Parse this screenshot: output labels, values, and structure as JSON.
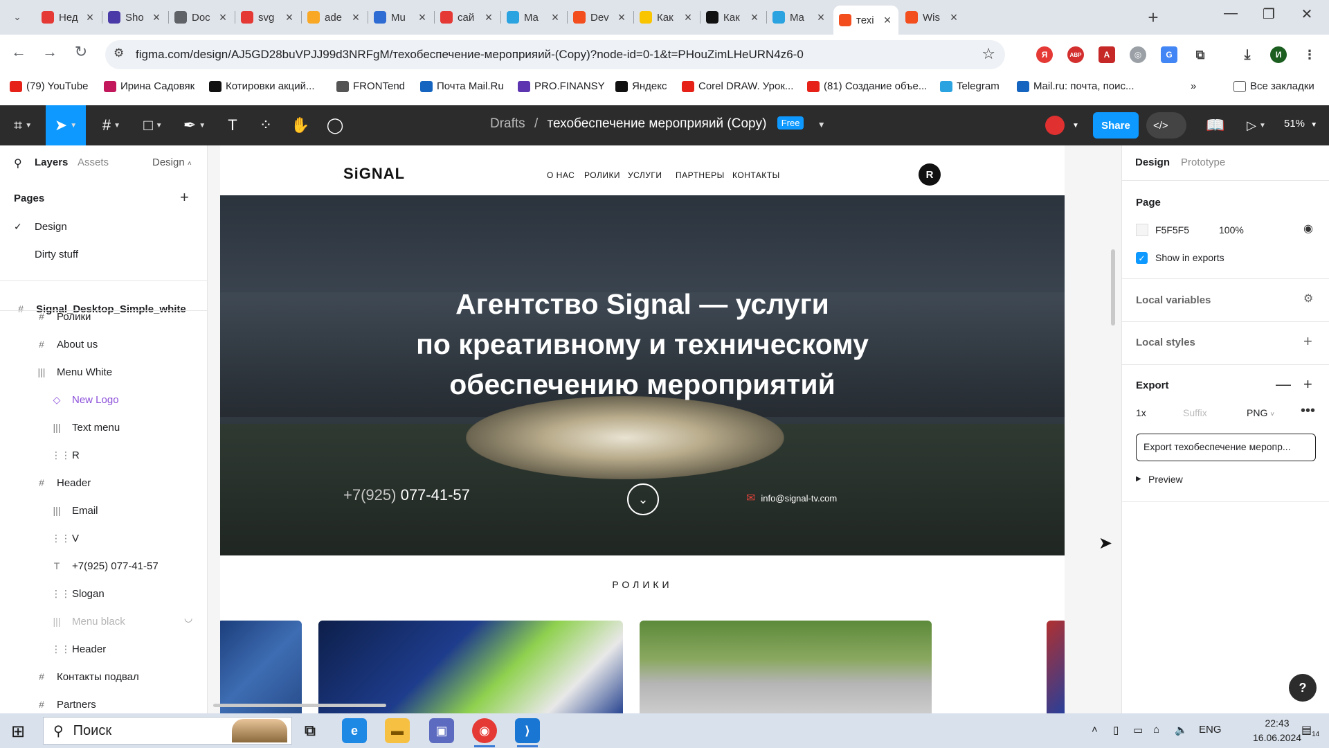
{
  "browser": {
    "tabs": [
      {
        "label": "Нед",
        "color": "#e53935"
      },
      {
        "label": "Sho",
        "color": "#4a3aa8"
      },
      {
        "label": "Doc",
        "color": "#5f6368"
      },
      {
        "label": "svg",
        "color": "#e53935"
      },
      {
        "label": "ade",
        "color": "#f9a825"
      },
      {
        "label": "Mu",
        "color": "#2e6bd3"
      },
      {
        "label": "сай",
        "color": "#e53935"
      },
      {
        "label": "Ma",
        "color": "#2aa3e0"
      },
      {
        "label": "Dev",
        "color": "#f24e1e"
      },
      {
        "label": "Как",
        "color": "#f9c400"
      },
      {
        "label": "Как",
        "color": "#111111"
      },
      {
        "label": "Ma",
        "color": "#2aa3e0"
      },
      {
        "label": "техі",
        "color": "#f24e1e",
        "active": true
      },
      {
        "label": "Wis",
        "color": "#f24e1e"
      }
    ],
    "url": "figma.com/design/AJ5GD28buVPJJ99d3NRFgM/техобеспечение-мероприяий-(Copy)?node-id=0-1&t=PHouZimLHeURN4z6-0",
    "profile_initial": "И",
    "bookmarks": [
      {
        "label": "(79) YouTube",
        "color": "#e62117"
      },
      {
        "label": "Ирина Садовяк",
        "color": "#c2185b"
      },
      {
        "label": "Котировки акций...",
        "color": "#111111"
      },
      {
        "label": "FRONTend",
        "color": "#555555"
      },
      {
        "label": "Почта Mail.Ru",
        "color": "#1565c0"
      },
      {
        "label": "PRO.FINANSY",
        "color": "#5e35b1"
      },
      {
        "label": "Яндекс",
        "color": "#111111"
      },
      {
        "label": "Corel DRAW. Урок...",
        "color": "#e62117"
      },
      {
        "label": "(81) Создание объе...",
        "color": "#e62117"
      },
      {
        "label": "Telegram",
        "color": "#2aa3e0"
      },
      {
        "label": "Mail.ru: почта, поис...",
        "color": "#1565c0"
      }
    ],
    "all_bookmarks": "Все закладки"
  },
  "figma": {
    "breadcrumb_root": "Drafts",
    "breadcrumb_sep": "/",
    "file_title": "техобеспечение мероприяий (Copy)",
    "plan_badge": "Free",
    "share_label": "Share",
    "zoom": "51%",
    "left": {
      "tab_layers": "Layers",
      "tab_assets": "Assets",
      "mode": "Design",
      "pages_title": "Pages",
      "pages": [
        {
          "label": "Design",
          "current": true
        },
        {
          "label": "Dirty stuff",
          "current": false
        }
      ],
      "frame_name": "Signal_Desktop_Simple_white",
      "layers": [
        {
          "label": "Ролики",
          "icon": "#",
          "indent": 44,
          "style": ""
        },
        {
          "label": "About us",
          "icon": "#",
          "indent": 44,
          "style": ""
        },
        {
          "label": "Menu White",
          "icon": "|||",
          "indent": 44,
          "style": ""
        },
        {
          "label": "New Logo",
          "icon": "◇",
          "indent": 66,
          "style": "purple"
        },
        {
          "label": "Text menu",
          "icon": "|||",
          "indent": 66,
          "style": ""
        },
        {
          "label": "R",
          "icon": "⋮⋮",
          "indent": 66,
          "style": ""
        },
        {
          "label": "Header",
          "icon": "#",
          "indent": 44,
          "style": ""
        },
        {
          "label": "Email",
          "icon": "|||",
          "indent": 66,
          "style": ""
        },
        {
          "label": "V",
          "icon": "⋮⋮",
          "indent": 66,
          "style": ""
        },
        {
          "label": "+7(925) 077-41-57",
          "icon": "T",
          "indent": 66,
          "style": ""
        },
        {
          "label": "Slogan",
          "icon": "⋮⋮",
          "indent": 66,
          "style": ""
        },
        {
          "label": "Menu black",
          "icon": "|||",
          "indent": 66,
          "style": "dim"
        },
        {
          "label": "Header",
          "icon": "⋮⋮",
          "indent": 66,
          "style": ""
        },
        {
          "label": "Контакты подвал",
          "icon": "#",
          "indent": 44,
          "style": ""
        },
        {
          "label": "Partners",
          "icon": "#",
          "indent": 44,
          "style": ""
        }
      ]
    },
    "right": {
      "tab_design": "Design",
      "tab_prototype": "Prototype",
      "page_title": "Page",
      "page_color": "F5F5F5",
      "page_opacity": "100%",
      "show_in_exports": "Show in exports",
      "local_variables": "Local variables",
      "local_styles": "Local styles",
      "export_title": "Export",
      "export_scale": "1x",
      "export_suffix_placeholder": "Suffix",
      "export_format": "PNG",
      "export_button": "Export техобеспечение меропр...",
      "preview": "Preview",
      "help": "?"
    }
  },
  "site": {
    "logo": "SiGNAL",
    "nav": [
      "О НАС",
      "РОЛИКИ",
      "УСЛУГИ",
      "ПАРТНЕРЫ",
      "КОНТАКТЫ"
    ],
    "avatar_letter": "R",
    "hero_lines": [
      "Агентство Signal — услуги",
      "по креативному и техническому",
      "обеспечению мероприятий"
    ],
    "phone_prefix": "+7(925)",
    "phone_number": "077-41-57",
    "email": "info@signal-tv.com",
    "section_title": "РОЛИКИ"
  },
  "taskbar": {
    "search": "Поиск",
    "lang": "ENG",
    "time": "22:43",
    "date": "16.06.2024",
    "notifications": "14"
  }
}
